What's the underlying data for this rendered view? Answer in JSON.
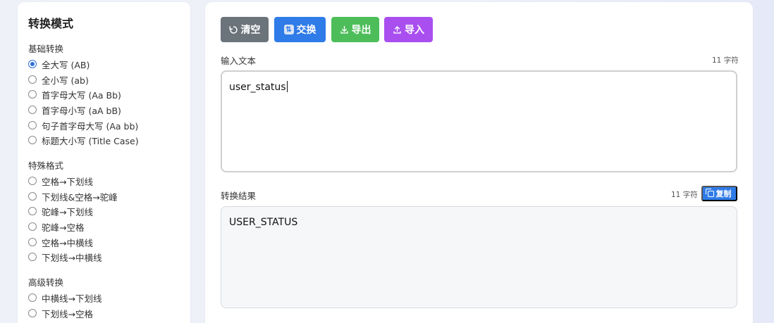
{
  "sidebar": {
    "title": "转换模式",
    "groups": [
      {
        "title": "基础转换",
        "options": [
          {
            "label": "全大写 (AB)",
            "checked": true
          },
          {
            "label": "全小写 (ab)",
            "checked": false
          },
          {
            "label": "首字母大写 (Aa Bb)",
            "checked": false
          },
          {
            "label": "首字母小写 (aA bB)",
            "checked": false
          },
          {
            "label": "句子首字母大写 (Aa bb)",
            "checked": false
          },
          {
            "label": "标题大小写 (Title Case)",
            "checked": false
          }
        ]
      },
      {
        "title": "特殊格式",
        "options": [
          {
            "label": "空格→下划线",
            "checked": false
          },
          {
            "label": "下划线&空格→驼峰",
            "checked": false
          },
          {
            "label": "驼峰→下划线",
            "checked": false
          },
          {
            "label": "驼峰→空格",
            "checked": false
          },
          {
            "label": "空格→中横线",
            "checked": false
          },
          {
            "label": "下划线→中横线",
            "checked": false
          }
        ]
      },
      {
        "title": "高级转换",
        "options": [
          {
            "label": "中横线→下划线",
            "checked": false
          },
          {
            "label": "下划线→空格",
            "checked": false
          }
        ]
      }
    ]
  },
  "toolbar": {
    "clear_label": "清空",
    "swap_label": "交换",
    "export_label": "导出",
    "import_label": "导入"
  },
  "input": {
    "label": "输入文本",
    "count": "11 字符",
    "value": "user_status"
  },
  "output": {
    "label": "转换结果",
    "count": "11 字符",
    "copy_label": "复制",
    "value": "USER_STATUS"
  },
  "colors": {
    "clear": "#6b737b",
    "swap": "#2f7be8",
    "export": "#4dbd5a",
    "import": "#a94ff0",
    "accent": "#2f7be8"
  },
  "icons": {
    "clear": "refresh-icon",
    "swap": "swap-icon",
    "export": "download-icon",
    "import": "upload-icon",
    "copy": "copy-icon"
  }
}
